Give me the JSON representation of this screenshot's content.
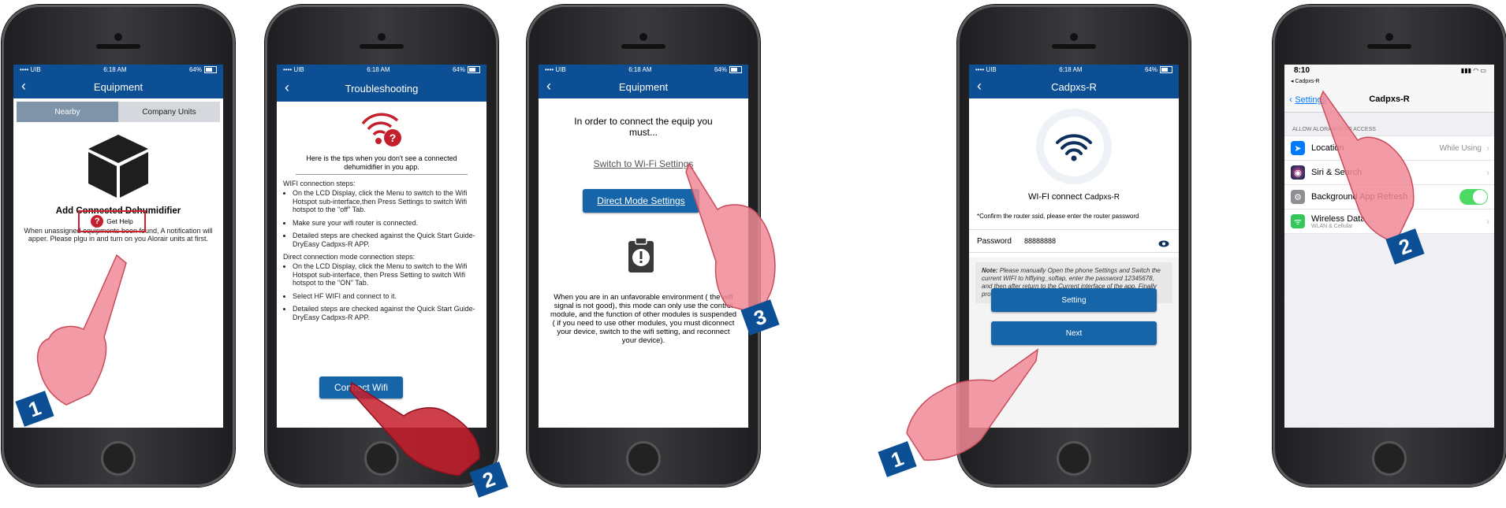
{
  "colors": {
    "brand_blue": "#0d4f94",
    "button_blue": "#1565a8",
    "highlight_red": "#d0222e",
    "ios_blue": "#007aff",
    "toggle_green": "#4cd964"
  },
  "phone1": {
    "status": {
      "carrier": "•••• UIB",
      "time": "6:18 AM",
      "battery": "64%"
    },
    "title": "Equipment",
    "tabs": [
      "Nearby",
      "Company Units"
    ],
    "heading": "Add Connected Dehumidifier",
    "description": "When unassigned equipments been found, A notification will apper. Please plgu in and turn on you Alorair units at first.",
    "help_label": "Get Help",
    "step": "1"
  },
  "phone2": {
    "status": {
      "carrier": "•••• UIB",
      "time": "6:18 AM",
      "battery": "64%"
    },
    "title": "Troubleshooting",
    "intro": "Here is the tips when you don't see a connected dehumidifier in you app.",
    "wifi_heading": "WIFI connection steps:",
    "wifi_steps": [
      "On the LCD Display, click the Menu to switch to the Wifi Hotspot sub-interface,then Press Settings to switch Wifi hotspot to the \"off\" Tab.",
      "Make sure your wifi router is connected.",
      "Detailed steps are checked against the Quick Start Guide-DryEasy Cadpxs-R APP."
    ],
    "direct_heading": "Direct connection mode connection steps:",
    "direct_steps": [
      "On the LCD Display, click the Menu to switch to the Wifi Hotspot sub-interface, then Press Setting to switch Wifi hotspot to the \"ON\" Tab.",
      "Select HF WIFI and connect to it.",
      "Detailed steps are checked against the Quick Start Guide-DryEasy Cadpxs-R APP."
    ],
    "button": "Connect Wifi",
    "step": "2"
  },
  "phone3": {
    "status": {
      "carrier": "•••• UIB",
      "time": "6:18 AM",
      "battery": "64%"
    },
    "title": "Equipment",
    "intro": "In order to connect the equip you must...",
    "wifi_link": "Switch to Wi-Fi Settings",
    "direct_button": "Direct Mode Settings",
    "note": "When you are in an unfavorable environment ( the wifi signal is not good), this mode can only use the control module, and the function of other modules is suspended ( if you need to use other modules, you must diconnect your device, switch to the wifi setting, and reconnect your device).",
    "step": "3"
  },
  "phone4": {
    "status": {
      "carrier": "•••• UIB",
      "time": "6:18 AM",
      "battery": "64%"
    },
    "title": "Cadpxs-R",
    "wifi_connect_prefix": "WI-FI connect",
    "wifi_connect_name": "Cadpxs-R",
    "confirm_text": "*Confirm the router ssid, please enter the router password",
    "password_label": "Password",
    "password_value": "88888888",
    "note_label": "Note:",
    "note_text": "Please manually Open the phone Settings and Switch the current WIFI to hlflying_softap, enter the password 12345678, and then after return to the Current interface of the app. Finally proceeds to the next step.",
    "setting_button": "Setting",
    "next_button": "Next",
    "step": "1"
  },
  "phone5": {
    "status": {
      "time": "8:10",
      "back_app": "◂ Cadpxs-R"
    },
    "back_label": "Settings",
    "title": "Cadpxs-R",
    "section": "ALLOW ALORAIR-R TO ACCESS",
    "rows": [
      {
        "label": "Location",
        "value": "While Using",
        "icon": "location-arrow-icon",
        "color": "#007aff"
      },
      {
        "label": "Siri & Search",
        "value": "",
        "icon": "siri-icon",
        "color": "#2c2c54"
      },
      {
        "label": "Background App Refresh",
        "value": "",
        "icon": "gear-icon",
        "color": "#8e8e93"
      },
      {
        "label": "Wireless Data",
        "sub": "WLAN & Cellular",
        "value": "",
        "icon": "antenna-icon",
        "color": "#34c759"
      }
    ],
    "step": "2"
  }
}
